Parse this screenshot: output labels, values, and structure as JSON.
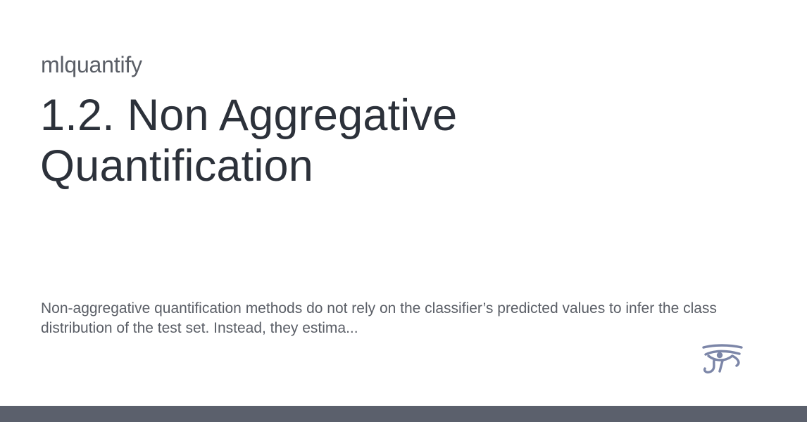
{
  "site": {
    "name": "mlquantify"
  },
  "page": {
    "title": "1.2. Non Aggregative Quantification",
    "description": "Non-aggregative quantification methods do not rely on the classifier’s predicted values to infer the class distribution of the test set. Instead, they estima..."
  },
  "logo": {
    "icon": "eye-of-horus-icon",
    "color": "#7c86a8"
  },
  "colors": {
    "title": "#2c313a",
    "text": "#5a5e66",
    "footer_bar": "#5b606c",
    "background": "#ffffff"
  }
}
